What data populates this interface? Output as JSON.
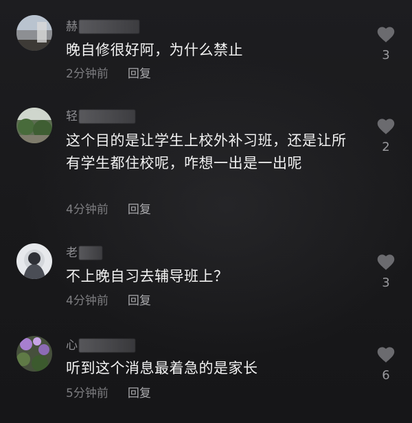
{
  "comments": [
    {
      "username_visible": "赫",
      "text": "晚自修很好阿，为什么禁止",
      "time": "2分钟前",
      "reply_label": "回复",
      "like_count": "3",
      "like_icon": "heart-icon"
    },
    {
      "username_visible": "轻",
      "text": "这个目的是让学生上校外补习班，还是让所有学生都住校呢，咋想一出是一出呢",
      "time": "4分钟前",
      "reply_label": "回复",
      "like_count": "2",
      "like_icon": "heart-icon"
    },
    {
      "username_visible": "老",
      "text": "不上晚自习去辅导班上？",
      "time": "4分钟前",
      "reply_label": "回复",
      "like_count": "3",
      "like_icon": "heart-icon"
    },
    {
      "username_visible": "心",
      "text": "听到这个消息最着急的是家长",
      "time": "5分钟前",
      "reply_label": "回复",
      "like_count": "6",
      "like_icon": "heart-icon"
    }
  ]
}
